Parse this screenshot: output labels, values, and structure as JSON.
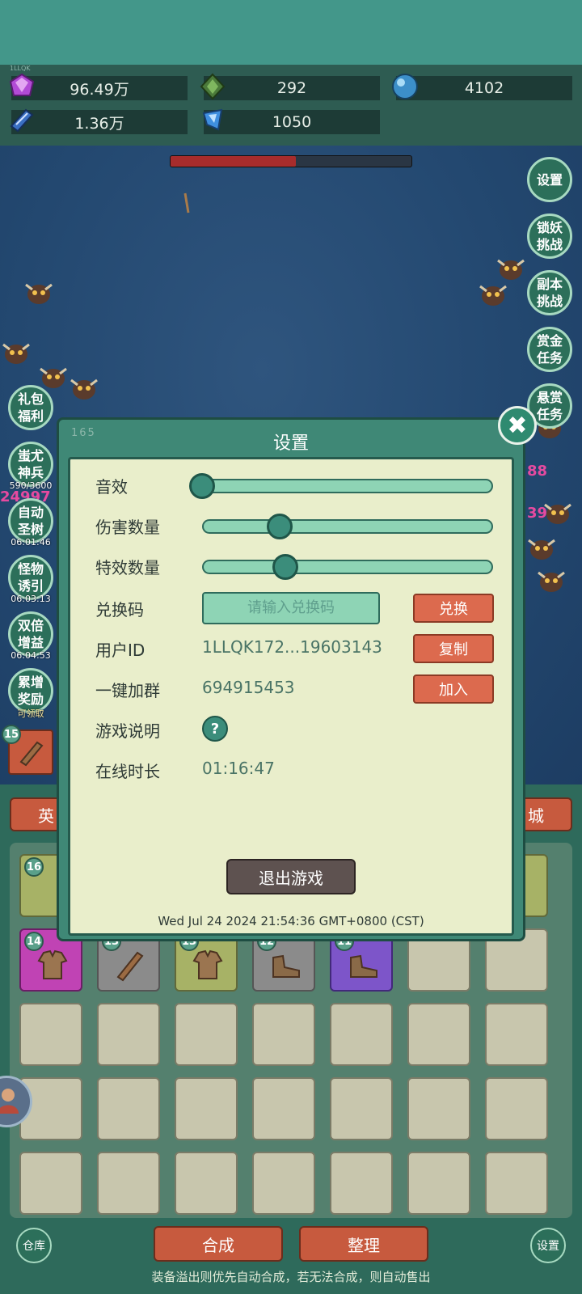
{
  "header": {
    "small_label": "1LLQK"
  },
  "resources": [
    {
      "icon": "purple-gem-icon",
      "value": "96.49万"
    },
    {
      "icon": "green-crystal-icon",
      "value": "292"
    },
    {
      "icon": "blue-orb-icon",
      "value": "4102"
    },
    {
      "icon": "blue-book-icon",
      "value": "1.36万"
    },
    {
      "icon": "blue-shard-icon",
      "value": "1050"
    }
  ],
  "boss_hp_fraction": 0.52,
  "right_menu": [
    "设置",
    "锁妖挑战",
    "副本挑战",
    "赏金任务",
    "悬赏任务"
  ],
  "left_menu": [
    {
      "label": "礼包福利",
      "sub": ""
    },
    {
      "label": "蚩尤神兵",
      "sub": "590/3600"
    },
    {
      "label": "自动圣树",
      "sub": "06:01:46"
    },
    {
      "label": "怪物诱引",
      "sub": "06:03:13"
    },
    {
      "label": "双倍增益",
      "sub": "06:04:53"
    },
    {
      "label": "累增奖励",
      "sub": "可领取"
    }
  ],
  "damage_numbers": [
    "24997",
    "88",
    "39"
  ],
  "inventory": {
    "tab_left": "英",
    "tab_right": "城",
    "slot_badges": [
      "15",
      "16",
      "14",
      "13",
      "13",
      "12",
      "11"
    ],
    "merge_button": "合成",
    "sort_button": "整理",
    "warehouse_button": "仓库",
    "settings_button": "设置",
    "footnote": "装备溢出则优先自动合成，若无法合成，则自动售出"
  },
  "dialog": {
    "corner_code": "165",
    "title": "设置",
    "sound_label": "音效",
    "sound_level": 0.0,
    "damage_count_label": "伤害数量",
    "damage_count_level": 0.28,
    "effect_count_label": "特效数量",
    "effect_count_level": 0.3,
    "redeem_label": "兑换码",
    "redeem_placeholder": "请输入兑换码",
    "redeem_button": "兑换",
    "user_id_label": "用户ID",
    "user_id_value": "1LLQK172...19603143",
    "copy_button": "复制",
    "join_group_label": "一键加群",
    "join_group_value": "694915453",
    "join_button": "加入",
    "game_help_label": "游戏说明",
    "help_icon": "?",
    "online_time_label": "在线时长",
    "online_time_value": "01:16:47",
    "exit_button": "退出游戏",
    "timestamp": "Wed Jul 24 2024 21:54:36 GMT+0800 (CST)",
    "close_icon": "✖"
  }
}
